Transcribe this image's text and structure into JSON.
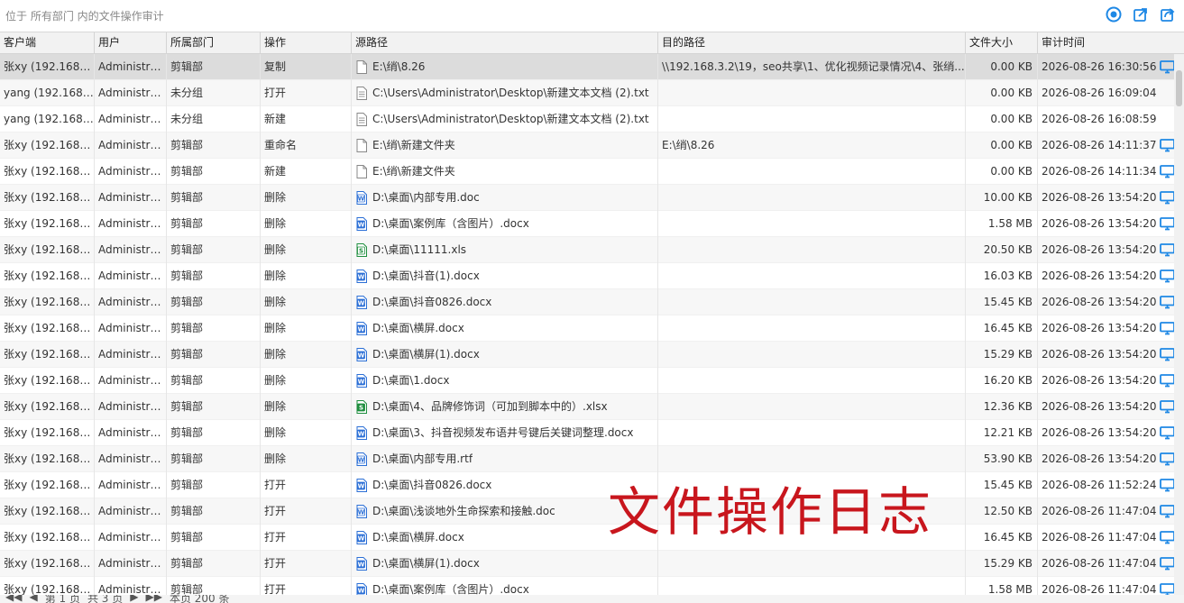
{
  "location_text": "位于 所有部门 内的文件操作审计",
  "top_icons": [
    "refresh-icon",
    "export-icon",
    "share-icon"
  ],
  "columns": {
    "client": "客户端",
    "user": "用户",
    "dept": "所属部门",
    "op": "操作",
    "src": "源路径",
    "dst": "目的路径",
    "size": "文件大小",
    "time": "审计时间"
  },
  "rows": [
    {
      "client": "张xy (192.168.3...",
      "user": "Administra...",
      "dept": "剪辑部",
      "op": "复制",
      "icon": "blank",
      "src": "E:\\绡\\8.26",
      "dst": "\\\\192.168.3.2\\19，seo共享\\1、优化视频记录情况\\4、张绡...",
      "size": "0.00 KB",
      "time": "2026-08-26 16:30:56",
      "pc": true
    },
    {
      "client": "yang (192.168....",
      "user": "Administra...",
      "dept": "未分组",
      "op": "打开",
      "icon": "text",
      "src": "C:\\Users\\Administrator\\Desktop\\新建文本文档 (2).txt",
      "dst": "",
      "size": "0.00 KB",
      "time": "2026-08-26 16:09:04",
      "pc": false
    },
    {
      "client": "yang (192.168....",
      "user": "Administra...",
      "dept": "未分组",
      "op": "新建",
      "icon": "text",
      "src": "C:\\Users\\Administrator\\Desktop\\新建文本文档 (2).txt",
      "dst": "",
      "size": "0.00 KB",
      "time": "2026-08-26 16:08:59",
      "pc": false
    },
    {
      "client": "张xy (192.168.3...",
      "user": "Administra...",
      "dept": "剪辑部",
      "op": "重命名",
      "icon": "blank",
      "src": "E:\\绡\\新建文件夹",
      "dst": "E:\\绡\\8.26",
      "size": "0.00 KB",
      "time": "2026-08-26 14:11:37",
      "pc": true
    },
    {
      "client": "张xy (192.168.3...",
      "user": "Administra...",
      "dept": "剪辑部",
      "op": "新建",
      "icon": "blank",
      "src": "E:\\绡\\新建文件夹",
      "dst": "",
      "size": "0.00 KB",
      "time": "2026-08-26 14:11:34",
      "pc": true
    },
    {
      "client": "张xy (192.168.3...",
      "user": "Administra...",
      "dept": "剪辑部",
      "op": "删除",
      "icon": "word-light",
      "src": "D:\\桌面\\内部专用.doc",
      "dst": "",
      "size": "10.00 KB",
      "time": "2026-08-26 13:54:20",
      "pc": true
    },
    {
      "client": "张xy (192.168.3...",
      "user": "Administra...",
      "dept": "剪辑部",
      "op": "删除",
      "icon": "word",
      "src": "D:\\桌面\\案例库（含图片）.docx",
      "dst": "",
      "size": "1.58 MB",
      "time": "2026-08-26 13:54:20",
      "pc": true
    },
    {
      "client": "张xy (192.168.3...",
      "user": "Administra...",
      "dept": "剪辑部",
      "op": "删除",
      "icon": "excel-light",
      "src": "D:\\桌面\\11111.xls",
      "dst": "",
      "size": "20.50 KB",
      "time": "2026-08-26 13:54:20",
      "pc": true
    },
    {
      "client": "张xy (192.168.3...",
      "user": "Administra...",
      "dept": "剪辑部",
      "op": "删除",
      "icon": "word",
      "src": "D:\\桌面\\抖音(1).docx",
      "dst": "",
      "size": "16.03 KB",
      "time": "2026-08-26 13:54:20",
      "pc": true
    },
    {
      "client": "张xy (192.168.3...",
      "user": "Administra...",
      "dept": "剪辑部",
      "op": "删除",
      "icon": "word",
      "src": "D:\\桌面\\抖音0826.docx",
      "dst": "",
      "size": "15.45 KB",
      "time": "2026-08-26 13:54:20",
      "pc": true
    },
    {
      "client": "张xy (192.168.3...",
      "user": "Administra...",
      "dept": "剪辑部",
      "op": "删除",
      "icon": "word",
      "src": "D:\\桌面\\横屏.docx",
      "dst": "",
      "size": "16.45 KB",
      "time": "2026-08-26 13:54:20",
      "pc": true
    },
    {
      "client": "张xy (192.168.3...",
      "user": "Administra...",
      "dept": "剪辑部",
      "op": "删除",
      "icon": "word",
      "src": "D:\\桌面\\横屏(1).docx",
      "dst": "",
      "size": "15.29 KB",
      "time": "2026-08-26 13:54:20",
      "pc": true
    },
    {
      "client": "张xy (192.168.3...",
      "user": "Administra...",
      "dept": "剪辑部",
      "op": "删除",
      "icon": "word",
      "src": "D:\\桌面\\1.docx",
      "dst": "",
      "size": "16.20 KB",
      "time": "2026-08-26 13:54:20",
      "pc": true
    },
    {
      "client": "张xy (192.168.3...",
      "user": "Administra...",
      "dept": "剪辑部",
      "op": "删除",
      "icon": "excel",
      "src": "D:\\桌面\\4、品牌修饰词（可加到脚本中的）.xlsx",
      "dst": "",
      "size": "12.36 KB",
      "time": "2026-08-26 13:54:20",
      "pc": true
    },
    {
      "client": "张xy (192.168.3...",
      "user": "Administra...",
      "dept": "剪辑部",
      "op": "删除",
      "icon": "word",
      "src": "D:\\桌面\\3、抖音视频发布语井号键后关键词整理.docx",
      "dst": "",
      "size": "12.21 KB",
      "time": "2026-08-26 13:54:20",
      "pc": true
    },
    {
      "client": "张xy (192.168.3...",
      "user": "Administra...",
      "dept": "剪辑部",
      "op": "删除",
      "icon": "word-light",
      "src": "D:\\桌面\\内部专用.rtf",
      "dst": "",
      "size": "53.90 KB",
      "time": "2026-08-26 13:54:20",
      "pc": true
    },
    {
      "client": "张xy (192.168.3...",
      "user": "Administra...",
      "dept": "剪辑部",
      "op": "打开",
      "icon": "word",
      "src": "D:\\桌面\\抖音0826.docx",
      "dst": "",
      "size": "15.45 KB",
      "time": "2026-08-26 11:52:24",
      "pc": true
    },
    {
      "client": "张xy (192.168.3...",
      "user": "Administra...",
      "dept": "剪辑部",
      "op": "打开",
      "icon": "word-light",
      "src": "D:\\桌面\\浅谈地外生命探索和接触.doc",
      "dst": "",
      "size": "12.50 KB",
      "time": "2026-08-26 11:47:04",
      "pc": true
    },
    {
      "client": "张xy (192.168.3...",
      "user": "Administra...",
      "dept": "剪辑部",
      "op": "打开",
      "icon": "word",
      "src": "D:\\桌面\\横屏.docx",
      "dst": "",
      "size": "16.45 KB",
      "time": "2026-08-26 11:47:04",
      "pc": true
    },
    {
      "client": "张xy (192.168.3...",
      "user": "Administra...",
      "dept": "剪辑部",
      "op": "打开",
      "icon": "word",
      "src": "D:\\桌面\\横屏(1).docx",
      "dst": "",
      "size": "15.29 KB",
      "time": "2026-08-26 11:47:04",
      "pc": true
    },
    {
      "client": "张xy (192.168.3...",
      "user": "Administra...",
      "dept": "剪辑部",
      "op": "打开",
      "icon": "word",
      "src": "D:\\桌面\\案例库（含图片）.docx",
      "dst": "",
      "size": "1.58 MB",
      "time": "2026-08-26 11:47:04",
      "pc": true
    }
  ],
  "selected_row": 0,
  "pager": {
    "first": "◀◀",
    "prev": "◀",
    "page": "第 1 页",
    "total_pages": "共 3 页",
    "next": "▶",
    "last": "▶▶",
    "count": "本页 200 条"
  },
  "overlay_text": "文件操作日志",
  "colors": {
    "accent": "#1e88e5",
    "word": "#2b6fd6",
    "excel": "#1e8e3e",
    "overlay": "#c8161d",
    "selected_row": "#dcdcdc"
  }
}
